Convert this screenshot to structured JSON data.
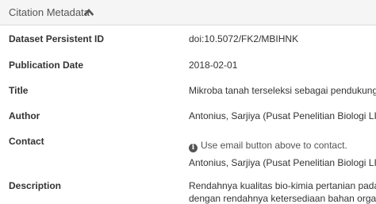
{
  "panel": {
    "title": "Citation Metadata",
    "toggle_icon": "chevron-up-icon"
  },
  "fields": {
    "dataset_id": {
      "label": "Dataset Persistent ID",
      "value": "doi:10.5072/FK2/MBIHNK"
    },
    "publication_date": {
      "label": "Publication Date",
      "value": "2018-02-01"
    },
    "title": {
      "label": "Title",
      "value": "Mikroba tanah terseleksi sebagai pendukung pe"
    },
    "author": {
      "label": "Author",
      "value": "Antonius, Sarjiya (Pusat Penelitian Biologi LIPI)"
    },
    "contact": {
      "label": "Contact",
      "info_icon": "info-circle-icon",
      "note": "Use email button above to contact.",
      "value": "Antonius, Sarjiya (Pusat Penelitian Biologi LIPI)"
    },
    "description": {
      "label": "Description",
      "line1": "Rendahnya kualitas bio-kimia pertanian pada tan",
      "line2": "dengan rendahnya ketersediaan bahan organik d"
    }
  }
}
